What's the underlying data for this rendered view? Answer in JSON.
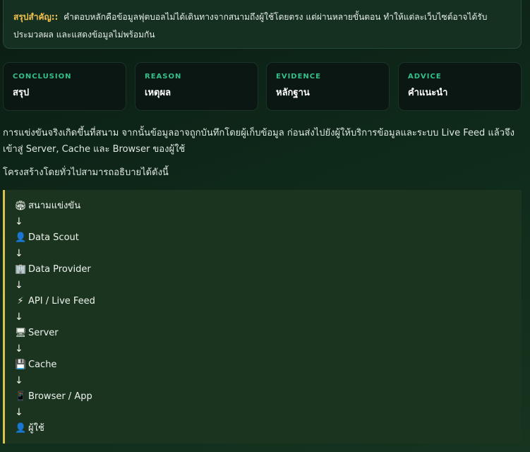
{
  "summary": {
    "label": "สรุปสำคัญ::",
    "text": "คำตอบหลักคือข้อมูลฟุตบอลไม่ได้เดินทางจากสนามถึงผู้ใช้โดยตรง แต่ผ่านหลายขั้นตอน ทำให้แต่ละเว็บไซต์อาจได้รับประมวลผล และแสดงข้อมูลไม่พร้อมกัน"
  },
  "cards": [
    {
      "key": "CONCLUSION",
      "value": "สรุป"
    },
    {
      "key": "REASON",
      "value": "เหตุผล"
    },
    {
      "key": "EVIDENCE",
      "value": "หลักฐาน"
    },
    {
      "key": "ADVICE",
      "value": "คำแนะนำ"
    }
  ],
  "paragraphs": {
    "p1": "การแข่งขันจริงเกิดขึ้นที่สนาม จากนั้นข้อมูลอาจถูกบันทึกโดยผู้เก็บข้อมูล ก่อนส่งไปยังผู้ให้บริการข้อมูลและระบบ Live Feed แล้วจึงเข้าสู่ Server, Cache และ Browser ของผู้ใช้",
    "p2": "โครงสร้างโดยทั่วไปสามารถอธิบายได้ดังนี้"
  },
  "flow": {
    "arrow": "↓",
    "steps": [
      {
        "icon": "stadium-icon",
        "glyph": "🏟",
        "label": "สนามแข่งขัน"
      },
      {
        "icon": "person-icon",
        "glyph": "👤",
        "label": "Data Scout"
      },
      {
        "icon": "building-icon",
        "glyph": "🏢",
        "label": "Data Provider"
      },
      {
        "icon": "lightning-icon",
        "glyph": "⚡",
        "label": "API / Live Feed"
      },
      {
        "icon": "monitor-icon",
        "glyph": "🖥",
        "label": "Server"
      },
      {
        "icon": "floppy-disk-icon",
        "glyph": "💾",
        "label": "Cache"
      },
      {
        "icon": "mobile-phone-icon",
        "glyph": "📱",
        "label": "Browser / App"
      },
      {
        "icon": "user-icon",
        "glyph": "👤",
        "label": "ผู้ใช้"
      }
    ]
  }
}
